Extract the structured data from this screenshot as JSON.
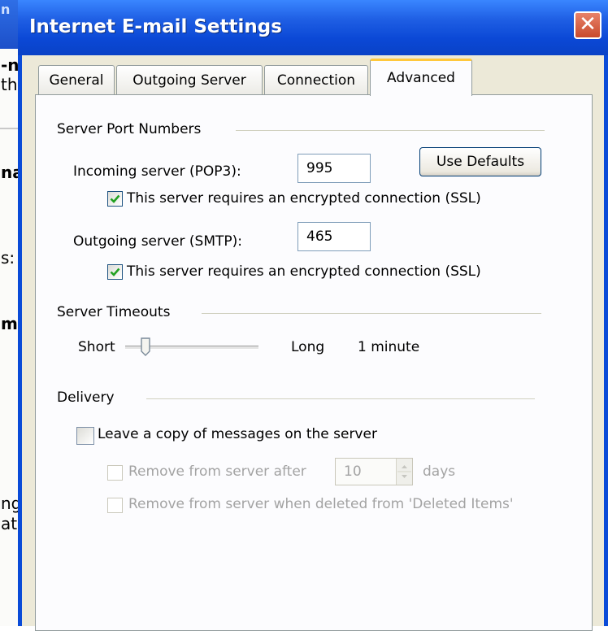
{
  "background_window": {
    "fragments": [
      "n",
      "-n",
      "th",
      "na",
      "s:",
      "m",
      "ng",
      "ati"
    ]
  },
  "dialog": {
    "title": "Internet E-mail Settings",
    "close_glyph": "✕",
    "tabs": [
      {
        "label": "General",
        "active": false
      },
      {
        "label": "Outgoing Server",
        "active": false
      },
      {
        "label": "Connection",
        "active": false
      },
      {
        "label": "Advanced",
        "active": true
      }
    ]
  },
  "ports": {
    "group_label": "Server Port Numbers",
    "incoming_label": "Incoming server (POP3):",
    "incoming_value": "995",
    "use_defaults_label": "Use Defaults",
    "incoming_ssl_label": "This server requires an encrypted connection (SSL)",
    "incoming_ssl_checked": true,
    "outgoing_label": "Outgoing server (SMTP):",
    "outgoing_value": "465",
    "outgoing_ssl_label": "This server requires an encrypted connection (SSL)",
    "outgoing_ssl_checked": true
  },
  "timeouts": {
    "group_label": "Server Timeouts",
    "short_label": "Short",
    "long_label": "Long",
    "value_text": "1 minute",
    "slider_position": 0.1
  },
  "delivery": {
    "group_label": "Delivery",
    "leave_copy_label": "Leave a copy of messages on the server",
    "leave_copy_checked": false,
    "remove_after_label": "Remove from server after",
    "remove_after_value": "10",
    "days_label": "days",
    "remove_deleted_label": "Remove from server when deleted from 'Deleted Items'"
  },
  "colors": {
    "titlebar": "#0a48d6",
    "tab_highlight": "#ffc83c",
    "checkmark": "#21a121",
    "dialog_face": "#ece9d8"
  }
}
